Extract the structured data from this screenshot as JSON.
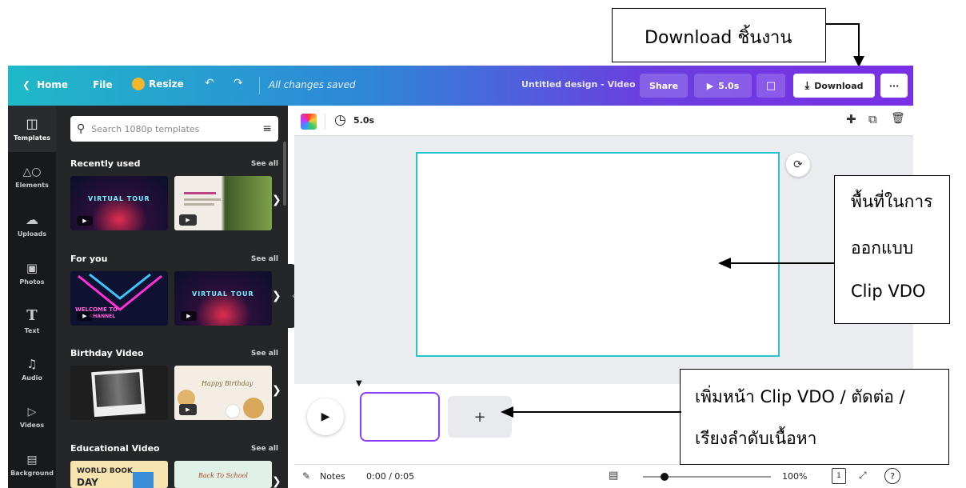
{
  "top_callout": "Download ชิ้นงาน",
  "right_callout": [
    "พื้นที่ในการ",
    "ออกแบบ",
    "Clip VDO"
  ],
  "bottom_callout": [
    "เพิ่มหน้า Clip VDO / ตัดต่อ /",
    "เรียงลำดับเนื้อหา"
  ],
  "topbar": {
    "home": "Home",
    "file": "File",
    "resize": "Resize",
    "saved": "All changes saved",
    "design_title": "Untitled design - Video",
    "share": "Share",
    "duration": "5.0s",
    "download": "Download",
    "more": "···"
  },
  "rail": [
    {
      "icon": "templates-icon",
      "label": "Templates"
    },
    {
      "icon": "elements-icon",
      "label": "Elements"
    },
    {
      "icon": "uploads-icon",
      "label": "Uploads"
    },
    {
      "icon": "photos-icon",
      "label": "Photos"
    },
    {
      "icon": "text-icon",
      "label": "Text"
    },
    {
      "icon": "audio-icon",
      "label": "Audio"
    },
    {
      "icon": "videos-icon",
      "label": "Videos"
    },
    {
      "icon": "background-icon",
      "label": "Background"
    }
  ],
  "panel": {
    "search_placeholder": "Search 1080p templates",
    "sections": [
      {
        "title": "Recently used",
        "see_all": "See all"
      },
      {
        "title": "For you",
        "see_all": "See all"
      },
      {
        "title": "Birthday Video",
        "see_all": "See all"
      },
      {
        "title": "Educational Video",
        "see_all": "See all"
      }
    ],
    "thumb_texts": {
      "virtual_tour": "VIRTUAL TOUR",
      "welcome": "WELCOME TO",
      "channel": "CHANNEL",
      "happy_birthday": "Happy Birthday",
      "world_book": "WORLD BOOK",
      "day": "DAY",
      "back_to_school": "Back To School"
    }
  },
  "toolstrip": {
    "duration": "5.0s"
  },
  "bottombar": {
    "notes": "Notes",
    "time": "0:00 / 0:05",
    "zoom": "100%",
    "page": "1",
    "help": "?"
  },
  "colors": {
    "canvas_border": "#28c4d0",
    "timeline_selected": "#8b3dff"
  }
}
